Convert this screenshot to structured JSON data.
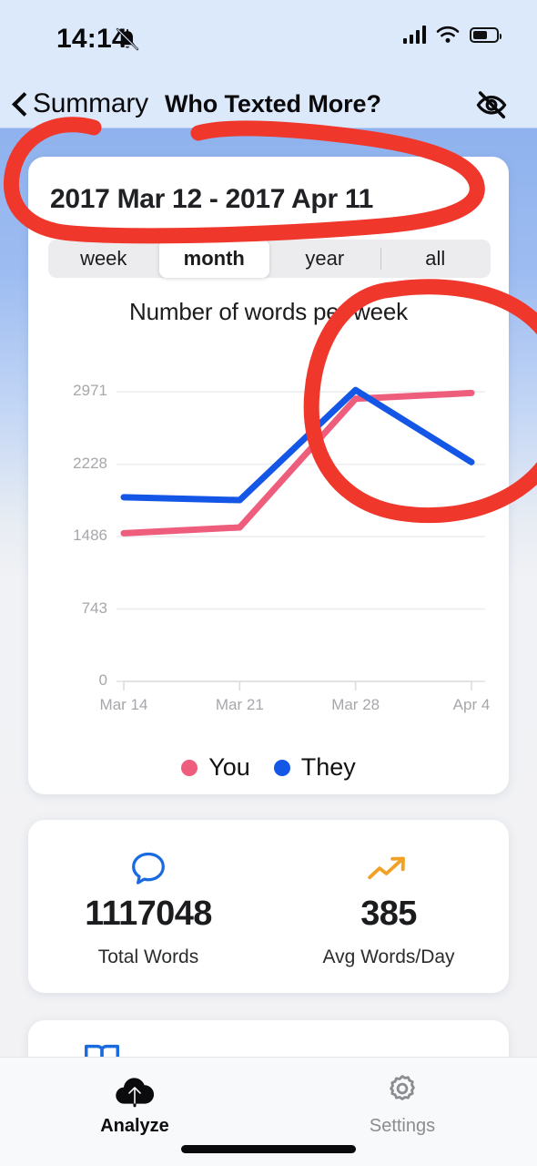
{
  "status_bar": {
    "time": "14:14",
    "icons": [
      "bell-slash-icon",
      "cellular-signal-icon",
      "wifi-icon",
      "battery-icon"
    ]
  },
  "nav": {
    "back_label": "Summary",
    "back_icon": "chevron-left-icon",
    "title": "Who Texted More?",
    "right_icon": "eye-slash-icon"
  },
  "chart_card": {
    "date_range": "2017 Mar 12 - 2017 Apr 11",
    "segments": [
      {
        "label": "week",
        "selected": false
      },
      {
        "label": "month",
        "selected": true
      },
      {
        "label": "year",
        "selected": false
      },
      {
        "label": "all",
        "selected": false
      }
    ]
  },
  "chart_data": {
    "type": "line",
    "title": "Number of words per week",
    "xlabel": "",
    "ylabel": "",
    "x": [
      "Mar 14",
      "Mar 21",
      "Mar 28",
      "Apr 4"
    ],
    "ytick_labels": [
      "2971",
      "2228",
      "1486",
      "743",
      "0"
    ],
    "ytick_values": [
      2971,
      2228,
      1486,
      743,
      0
    ],
    "ylim": [
      0,
      3300
    ],
    "grid": true,
    "legend_position": "bottom",
    "series": [
      {
        "name": "You",
        "color": "#ef5d7d",
        "values": [
          1520,
          1580,
          2900,
          2960
        ]
      },
      {
        "name": "They",
        "color": "#1457e6",
        "values": [
          1890,
          1860,
          2990,
          2250
        ]
      }
    ]
  },
  "stats": [
    {
      "icon": "chat-bubble-icon",
      "value": "1117048",
      "label": "Total Words",
      "color": "#1a6be0"
    },
    {
      "icon": "trend-up-icon",
      "value": "385",
      "label": "Avg Words/Day",
      "color": "#f0a227"
    }
  ],
  "third_card": {
    "icon": "book-icon",
    "color": "#1a6be0"
  },
  "tab_bar": {
    "tabs": [
      {
        "label": "Analyze",
        "icon": "cloud-upload-icon",
        "active": true
      },
      {
        "label": "Settings",
        "icon": "gear-icon",
        "active": false
      }
    ]
  },
  "annotations": {
    "color": "#f0372c",
    "shapes": [
      "ellipse-around-date-range",
      "circle-around-chart-peak"
    ]
  }
}
